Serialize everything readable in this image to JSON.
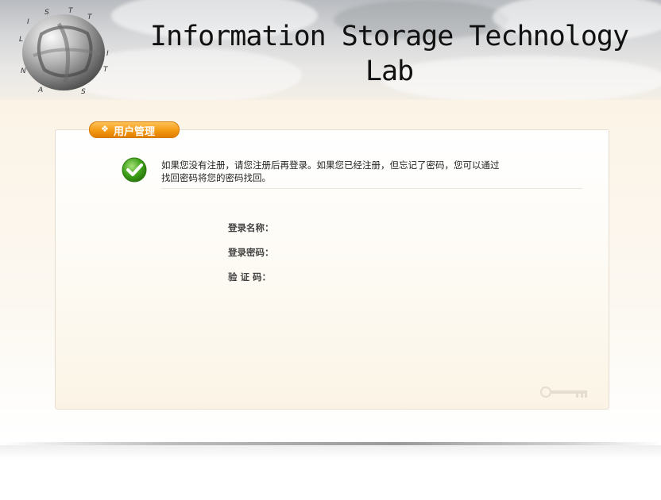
{
  "header": {
    "title_line1": "Information Storage Technology",
    "title_line2": "Lab",
    "logo_letters": [
      "L",
      "I",
      "S",
      "T",
      "T",
      "I",
      "T",
      "S",
      "A",
      "N"
    ]
  },
  "panel": {
    "tab_label": "用户管理",
    "tab_arrow": "❖",
    "message_line1": "如果您没有注册，请您注册后再登录。如果您已经注册，但忘记了密码，您可以通过",
    "message_line2": "找回密码将您的密码找回。",
    "fields": {
      "username_label": "登录名称：",
      "password_label": "登录密码：",
      "captcha_label": "验 证 码："
    }
  },
  "colors": {
    "tab_orange": "#f39a12",
    "check_green": "#3fa21a"
  },
  "icons": [
    "globe-logo-icon",
    "checkmark-icon",
    "key-icon",
    "diamond-arrow-icon"
  ]
}
